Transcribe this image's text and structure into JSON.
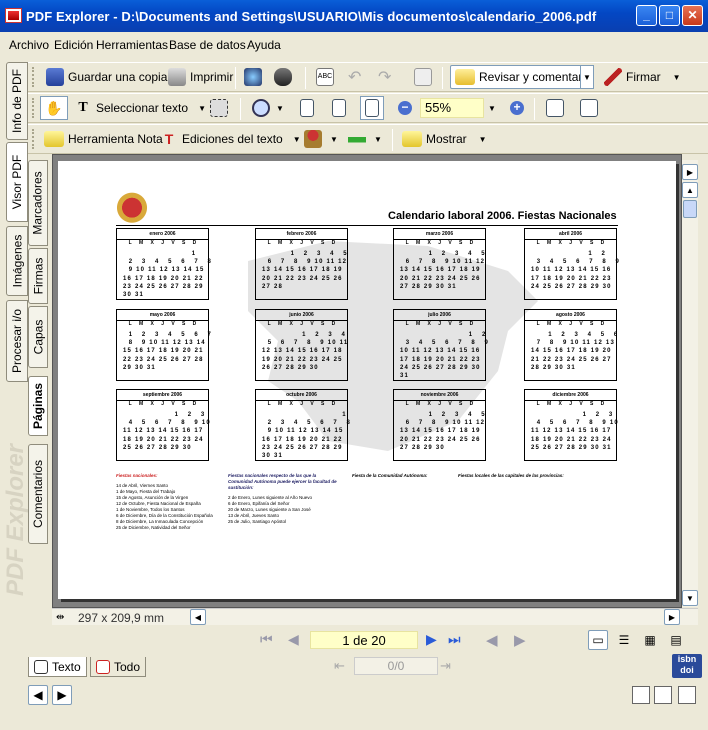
{
  "window": {
    "title": "PDF Explorer - D:\\Documents and Settings\\USUARIO\\Mis documentos\\calendario_2006.pdf"
  },
  "menu": [
    "Archivo",
    "Edición",
    "Herramientas",
    "Base de datos",
    "Ayuda"
  ],
  "toolbar1": {
    "save_copy": "Guardar una copia",
    "print": "Imprimir",
    "review": "Revisar y comentar",
    "sign": "Firmar"
  },
  "toolbar2": {
    "select_text": "Seleccionar texto",
    "zoom": "55%"
  },
  "toolbar3": {
    "note_tool": "Herramienta Nota",
    "text_edits": "Ediciones del texto",
    "show": "Mostrar"
  },
  "left_tabs": [
    "Info de PDF",
    "Visor PDF",
    "Imágenes",
    "Procesar i/o"
  ],
  "side_panel_tabs": [
    "Marcadores",
    "Firmas",
    "Capas",
    "Páginas",
    "Comentarios"
  ],
  "brand_watermark": "PDF Explorer",
  "document": {
    "title": "Calendario laboral 2006. Fiestas Nacionales",
    "day_headers": [
      "L",
      "M",
      "X",
      "J",
      "V",
      "S",
      "D"
    ],
    "months": [
      {
        "name": "enero 2006",
        "rows": [
          "                        1",
          "  2   3   4   5   6   7   8",
          "  9 10 11 12 13 14 15",
          "16 17 18 19 20 21 22",
          "23 24 25 26 27 28 29",
          "30 31"
        ]
      },
      {
        "name": "febrero 2006",
        "rows": [
          "          1   2   3   4   5",
          "  6   7   8   9 10 11 12",
          "13 14 15 16 17 18 19",
          "20 21 22 23 24 25 26",
          "27 28"
        ]
      },
      {
        "name": "marzo 2006",
        "rows": [
          "          1   2   3   4   5",
          "  6   7   8   9 10 11 12",
          "13 14 15 16 17 18 19",
          "20 21 22 23 24 25 26",
          "27 28 29 30 31"
        ]
      },
      {
        "name": "abril 2006",
        "rows": [
          "                    1   2",
          "  3   4   5   6   7   8   9",
          "10 11 12 13 14 15 16",
          "17 18 19 20 21 22 23",
          "24 25 26 27 28 29 30"
        ]
      },
      {
        "name": "mayo 2006",
        "rows": [
          "  1   2   3   4   5   6   7",
          "  8   9 10 11 12 13 14",
          "15 16 17 18 19 20 21",
          "22 23 24 25 26 27 28",
          "29 30 31"
        ]
      },
      {
        "name": "junio 2006",
        "rows": [
          "              1   2   3   4",
          "  5   6   7   8   9 10 11",
          "12 13 14 15 16 17 18",
          "19 20 21 22 23 24 25",
          "26 27 28 29 30"
        ]
      },
      {
        "name": "julio 2006",
        "rows": [
          "                        1   2",
          "  3   4   5   6   7   8   9",
          "10 11 12 13 14 15 16",
          "17 18 19 20 21 22 23",
          "24 25 26 27 28 29 30",
          "31"
        ]
      },
      {
        "name": "agosto 2006",
        "rows": [
          "      1   2   3   4   5   6",
          "  7   8   9 10 11 12 13",
          "14 15 16 17 18 19 20",
          "21 22 23 24 25 26 27",
          "28 29 30 31"
        ]
      },
      {
        "name": "septiembre 2006",
        "rows": [
          "                  1   2   3",
          "  4   5   6   7   8   9 10",
          "11 12 13 14 15 16 17",
          "18 19 20 21 22 23 24",
          "25 26 27 28 29 30"
        ]
      },
      {
        "name": "octubre 2006",
        "rows": [
          "                            1",
          "  2   3   4   5   6   7   8",
          "  9 10 11 12 13 14 15",
          "16 17 18 19 20 21 22",
          "23 24 25 26 27 28 29",
          "30 31"
        ]
      },
      {
        "name": "noviembre 2006",
        "rows": [
          "          1   2   3   4   5",
          "  6   7   8   9 10 11 12",
          "13 14 15 16 17 18 19",
          "20 21 22 23 24 25 26",
          "27 28 29 30"
        ]
      },
      {
        "name": "diciembre 2006",
        "rows": [
          "                  1   2   3",
          "  4   5   6   7   8   9 10",
          "11 12 13 14 15 16 17",
          "18 19 20 21 22 23 24",
          "25 26 27 28 29 30 31"
        ]
      }
    ],
    "legend": {
      "national": {
        "heading": "Fiestas nacionales:",
        "items": [
          "14 de Abril, Viernes Santo",
          "1 de Mayo, Fiesta del Trabajo",
          "15 de Agosto, Asunción de la Virgen",
          "12 de Octubre, Fiesta Nacional de España",
          "1 de Noviembre, Todos los Santos",
          "6 de Diciembre, Día de la Constitución Española",
          "8 de Diciembre, La Inmaculada Concepción",
          "25 de Diciembre, Natividad del Señor"
        ]
      },
      "substitution": {
        "heading": "Fiestas nacionales respecto de las que la Comunidad Autónoma puede ejercer la facultad de sustitución:",
        "items": [
          "2 de Enero, Lunes siguiente al Año Nuevo",
          "6 de Enero, Epifanía del Señor",
          "20 de Marzo, Lunes siguiente a San José",
          "13 de Abril, Jueves Santo",
          "25 de Julio, Santiago Apóstol"
        ]
      },
      "community": {
        "heading": "Fiesta de la Comunidad Autónoma:"
      },
      "local": {
        "heading": "Fiestas locales de las capitales de las provincias:"
      }
    }
  },
  "status": {
    "page_size": "297 x 209,9 mm",
    "page_indicator": "1 de 20",
    "sub_page": "0/0"
  },
  "bottom_tabs": {
    "text": "Texto",
    "all": "Todo"
  },
  "brand_badge": "isbn doi"
}
